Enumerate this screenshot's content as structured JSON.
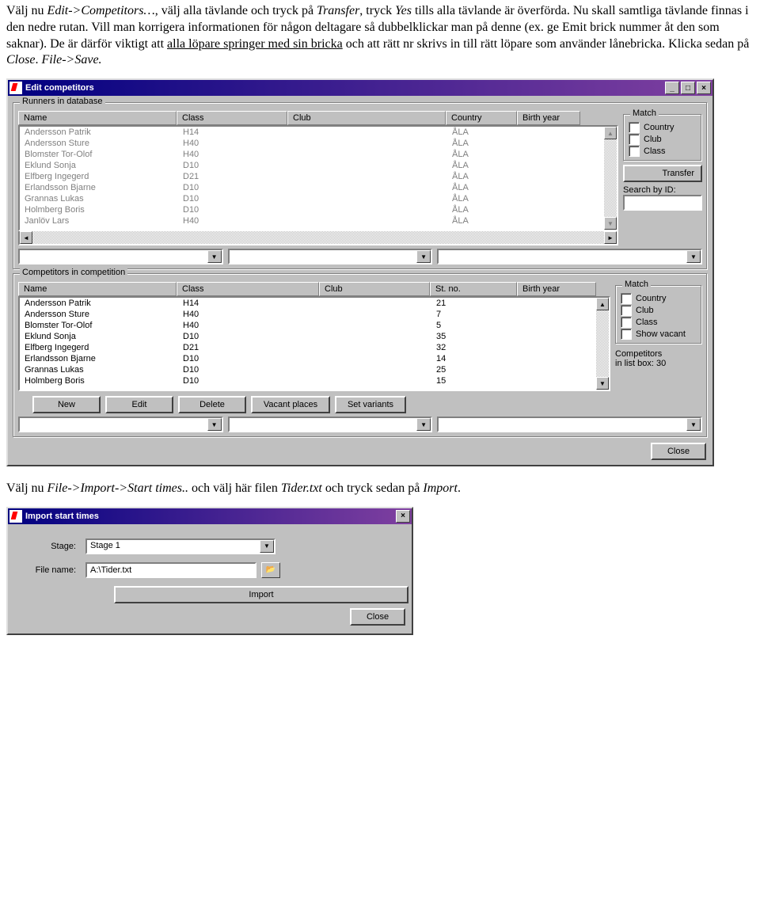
{
  "doc": {
    "p1a": "Välj nu ",
    "p1b": "Edit->Competitors…",
    "p1c": ", välj alla tävlande och tryck på ",
    "p1d": "Transfer",
    "p1e": ", tryck ",
    "p1f": "Yes",
    "p1g": " tills alla tävlande är överförda. Nu skall samtliga tävlande finnas i den nedre rutan. Vill man korrigera informationen för någon deltagare så dubbelklickar man på denne (ex. ge Emit brick nummer åt den som saknar). De är därför viktigt att ",
    "p1u": "alla löpare springer med sin bricka",
    "p1h": " och att rätt nr skrivs in till rätt löpare som använder lånebricka. Klicka sedan på ",
    "p1i": "Close",
    "p1j": ". ",
    "p1k": "File->Save.",
    "p2a": "Välj nu ",
    "p2b": "File->Import->Start times..",
    "p2c": " och välj här filen ",
    "p2d": "Tider.txt ",
    "p2e": "och tryck sedan på ",
    "p2f": "Import",
    "p2g": "."
  },
  "win1": {
    "title": "Edit competitors",
    "group1_legend": "Runners in database",
    "group2_legend": "Competitors in competition",
    "cols1": {
      "name": "Name",
      "class": "Class",
      "club": "Club",
      "country": "Country",
      "birth": "Birth year"
    },
    "cols2": {
      "name": "Name",
      "class": "Class",
      "club": "Club",
      "stno": "St. no.",
      "birth": "Birth year"
    },
    "match_legend": "Match",
    "chk_country": "Country",
    "chk_club": "Club",
    "chk_class": "Class",
    "chk_showvacant": "Show vacant",
    "transfer_btn": "Transfer",
    "search_label": "Search by ID:",
    "comp_label1": "Competitors",
    "comp_label2": "in list box:  30",
    "btn_new": "New",
    "btn_edit": "Edit",
    "btn_delete": "Delete",
    "btn_vacant": "Vacant places",
    "btn_setvar": "Set variants",
    "btn_close": "Close",
    "rows1": [
      {
        "name": "Andersson Patrik",
        "class": "H14",
        "club": "",
        "country": "ÅLA",
        "birth": ""
      },
      {
        "name": "Andersson Sture",
        "class": "H40",
        "club": "",
        "country": "ÅLA",
        "birth": ""
      },
      {
        "name": "Blomster Tor-Olof",
        "class": "H40",
        "club": "",
        "country": "ÅLA",
        "birth": ""
      },
      {
        "name": "Eklund Sonja",
        "class": "D10",
        "club": "",
        "country": "ÅLA",
        "birth": ""
      },
      {
        "name": "Elfberg Ingegerd",
        "class": "D21",
        "club": "",
        "country": "ÅLA",
        "birth": ""
      },
      {
        "name": "Erlandsson Bjarne",
        "class": "D10",
        "club": "",
        "country": "ÅLA",
        "birth": ""
      },
      {
        "name": "Grannas Lukas",
        "class": "D10",
        "club": "",
        "country": "ÅLA",
        "birth": ""
      },
      {
        "name": "Holmberg Boris",
        "class": "D10",
        "club": "",
        "country": "ÅLA",
        "birth": ""
      },
      {
        "name": "Janlöv Lars",
        "class": "H40",
        "club": "",
        "country": "ÅLA",
        "birth": ""
      }
    ],
    "rows2": [
      {
        "name": "Andersson Patrik",
        "class": "H14",
        "club": "",
        "stno": "21",
        "birth": ""
      },
      {
        "name": "Andersson Sture",
        "class": "H40",
        "club": "",
        "stno": "7",
        "birth": ""
      },
      {
        "name": "Blomster Tor-Olof",
        "class": "H40",
        "club": "",
        "stno": "5",
        "birth": ""
      },
      {
        "name": "Eklund Sonja",
        "class": "D10",
        "club": "",
        "stno": "35",
        "birth": ""
      },
      {
        "name": "Elfberg Ingegerd",
        "class": "D21",
        "club": "",
        "stno": "32",
        "birth": ""
      },
      {
        "name": "Erlandsson Bjarne",
        "class": "D10",
        "club": "",
        "stno": "14",
        "birth": ""
      },
      {
        "name": "Grannas Lukas",
        "class": "D10",
        "club": "",
        "stno": "25",
        "birth": ""
      },
      {
        "name": "Holmberg Boris",
        "class": "D10",
        "club": "",
        "stno": "15",
        "birth": ""
      }
    ]
  },
  "win2": {
    "title": "Import start times",
    "stage_label": "Stage:",
    "stage_value": "Stage 1",
    "file_label": "File name:",
    "file_value": "A:\\Tider.txt",
    "btn_import": "Import",
    "btn_close": "Close"
  }
}
